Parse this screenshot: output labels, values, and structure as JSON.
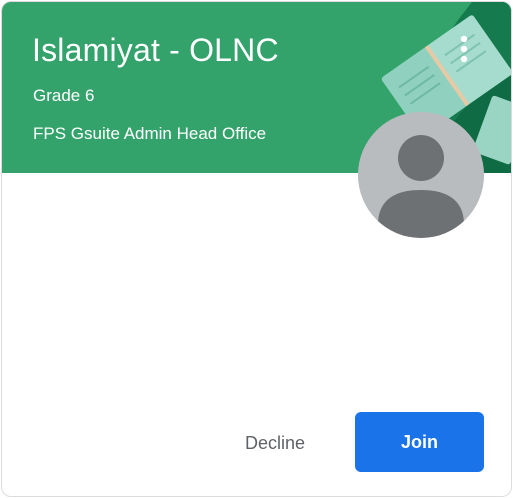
{
  "class_card": {
    "title": "Islamiyat - OLNC",
    "section": "Grade 6",
    "owner": "FPS Gsuite Admin Head Office",
    "header_color": "#33a36b",
    "more_icon": "more-vert-icon",
    "avatar_icon": "person-avatar-icon",
    "actions": {
      "decline_label": "Decline",
      "join_label": "Join",
      "join_color": "#1a73e8"
    }
  }
}
